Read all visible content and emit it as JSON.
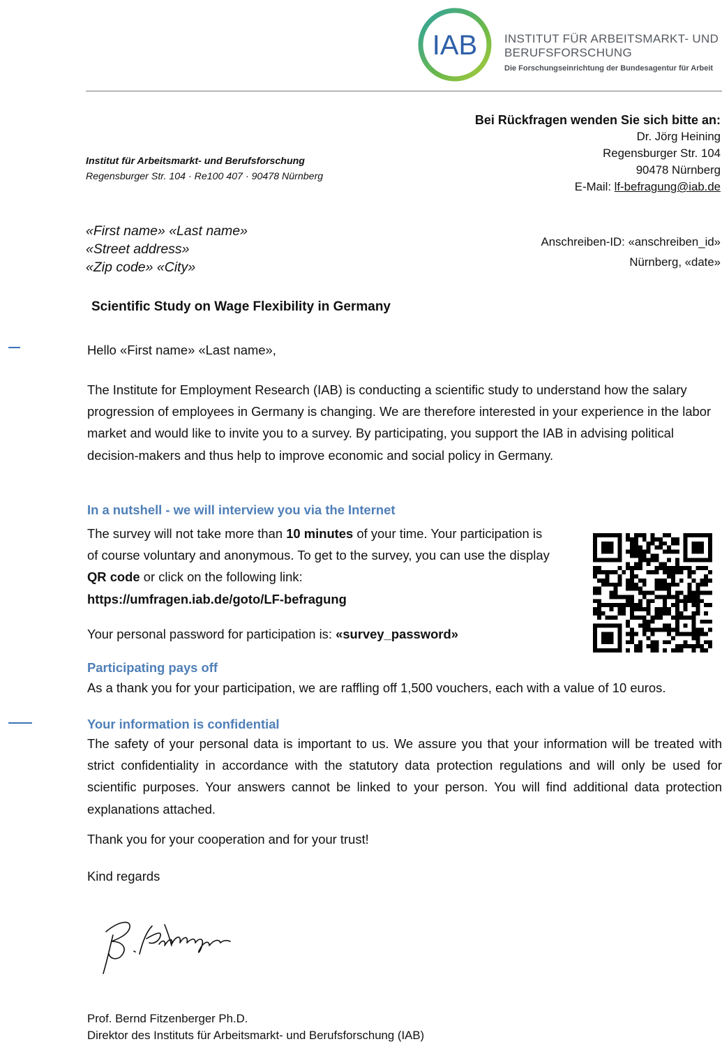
{
  "logo": {
    "abbr": "IAB",
    "line1": "INSTITUT FÜR ARBEITSMARKT- UND",
    "line2": "BERUFSFORSCHUNG",
    "line3": "Die Forschungseinrichtung der Bundesagentur für Arbeit",
    "colors": {
      "ring_start": "#3aa9a0",
      "ring_end": "#9bc53d",
      "text": "#2e5fa8"
    }
  },
  "sender": {
    "name": "Institut für Arbeitsmarkt- und Berufsforschung",
    "address": "Regensburger Str. 104 · Re100 407 · 90478 Nürnberg"
  },
  "contact": {
    "heading": "Bei Rückfragen wenden Sie sich bitte an:",
    "person": "Dr. Jörg Heining",
    "street": "Regensburger Str. 104",
    "city": "90478 Nürnberg",
    "email_label": "E-Mail: ",
    "email": "lf-befragung@iab.de"
  },
  "recipient": {
    "line1": "«First name» «Last name»",
    "line2": "«Street address»",
    "line3": "«Zip code» «City»"
  },
  "meta": {
    "id_line": "Anschreiben-ID: «anschreiben_id»",
    "date_line": "Nürnberg, «date»"
  },
  "subject": "Scientific Study on Wage Flexibility in Germany",
  "greeting": "Hello «First name» «Last name»,",
  "intro": "The Institute for Employment Research (IAB) is conducting a scientific study to understand how the salary progression of employees in Germany is changing. We are therefore interested in your experience in the labor market and would like to invite you to a survey. By participating, you support the IAB in advising political decision-makers and thus help to improve economic and social policy in Germany.",
  "section1": {
    "heading": "In a nutshell - we will interview you via the Internet",
    "t1": "The survey will not take more than ",
    "b1": "10 minutes",
    "t2": " of your time. Your participation is of course voluntary and anonymous. To get to the survey, you can use the display ",
    "b2": "QR code",
    "t3": " or click on the following link:",
    "link": "https://umfragen.iab.de/goto/LF-befragung",
    "pw_text": "Your personal password for participation is: ",
    "pw_value": "«survey_password»"
  },
  "section2": {
    "heading": "Participating pays off",
    "text": "As a thank you for your participation, we are raffling off 1,500 vouchers, each with a value of 10 euros."
  },
  "section3": {
    "heading": "Your information is confidential",
    "text": "The safety of your personal data is important to us. We assure you that your information will be treated with strict confidentiality in accordance with the statutory data protection regulations and will only be used for scientific purposes. Your answers cannot be linked to your person. You will find additional data protection explanations attached."
  },
  "thanks": "Thank you for your cooperation and for your trust!",
  "closing": "Kind regards",
  "signer": {
    "name": "Prof. Bernd Fitzenberger Ph.D.",
    "title": "Direktor des Instituts für Arbeitsmarkt- und Berufsforschung (IAB)"
  }
}
